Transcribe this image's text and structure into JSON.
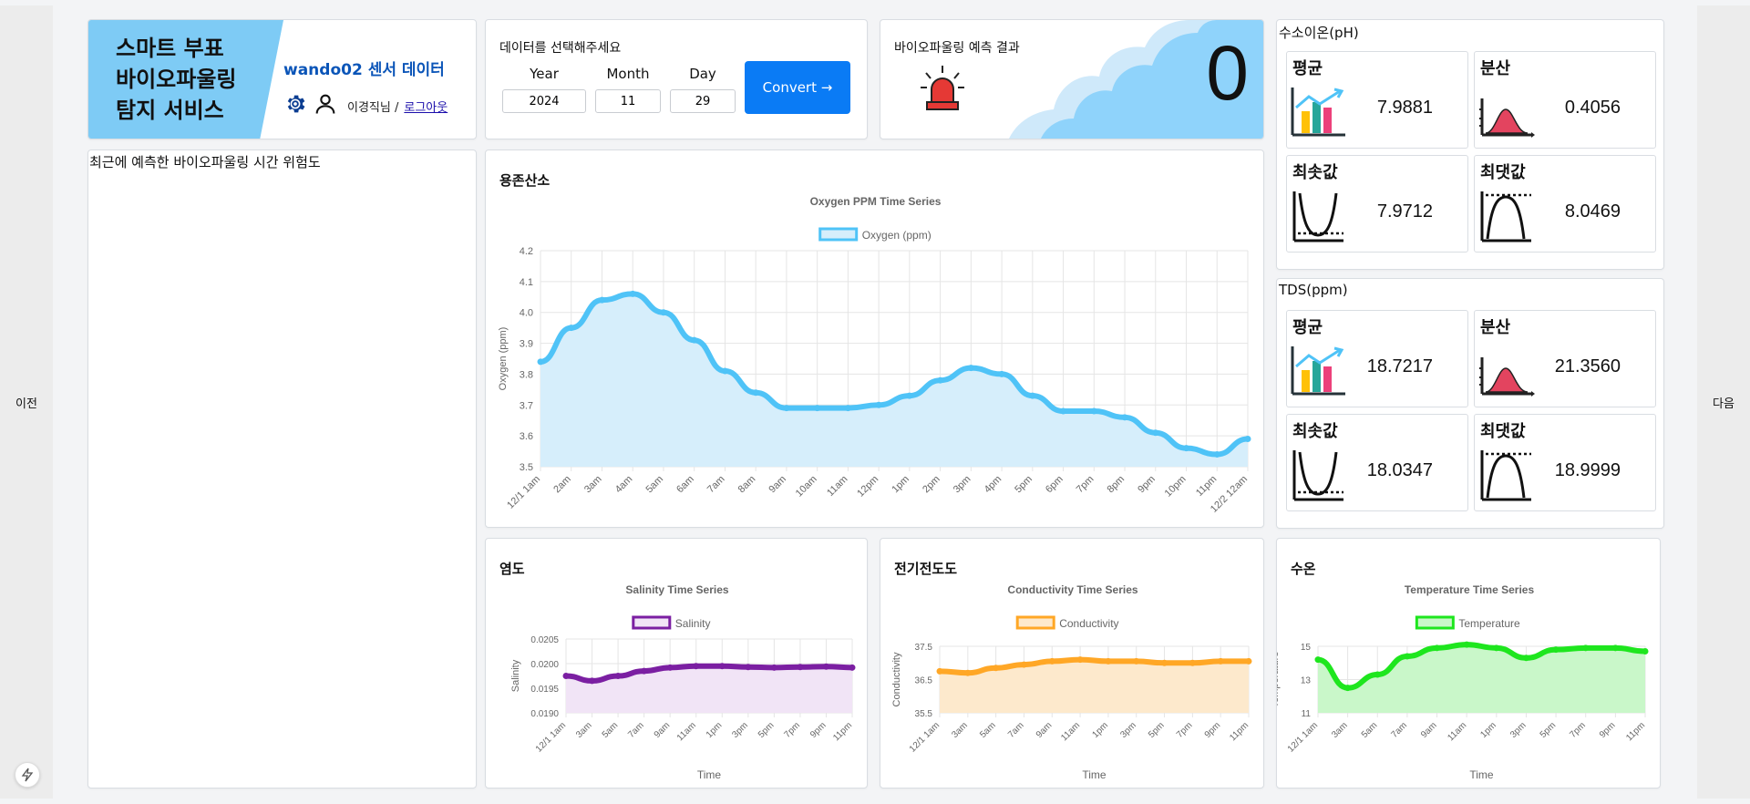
{
  "nav": {
    "prev": "이전",
    "next": "다음"
  },
  "brand": {
    "title_lines": [
      "스마트 부표",
      "바이오파울링",
      "탐지 서비스"
    ],
    "subtitle": "wando02 센서 데이터",
    "user_text": "이경직님 / ",
    "logout": "로그아웃"
  },
  "date_selector": {
    "label": "데이터를 선택해주세요",
    "year_label": "Year",
    "month_label": "Month",
    "day_label": "Day",
    "year": "2024",
    "month": "11",
    "day": "29",
    "convert_label": "Convert →"
  },
  "prediction": {
    "label": "바이오파울링 예측 결과",
    "result": "0"
  },
  "recent": {
    "label": "최근에 예측한 바이오파울링 시간 위험도"
  },
  "colors": {
    "oxygen": "#4fc3f7",
    "oxygen_fill": "#d6eefb",
    "salinity": "#7b1fa2",
    "salinity_fill": "#f1e4f6",
    "conductivity": "#ffa726",
    "conductivity_fill": "#fde9cc",
    "temperature": "#1ee61e",
    "temperature_fill": "#c9f7c9",
    "button": "#0a7bf5",
    "brand_blue": "#7ecbf5"
  },
  "chart_data": [
    {
      "id": "oxygen",
      "panel_label": "용존산소",
      "type": "line",
      "title": "Oxygen PPM Time Series",
      "legend": "Oxygen (ppm)",
      "xlabel": "",
      "ylabel": "Oxygen (ppm)",
      "ylim": [
        3.5,
        4.2
      ],
      "yticks": [
        3.5,
        3.6,
        3.7,
        3.8,
        3.9,
        4.0,
        4.1,
        4.2
      ],
      "categories": [
        "12/1 1am",
        "2am",
        "3am",
        "4am",
        "5am",
        "6am",
        "7am",
        "8am",
        "9am",
        "10am",
        "11am",
        "12pm",
        "1pm",
        "2pm",
        "3pm",
        "4pm",
        "5pm",
        "6pm",
        "7pm",
        "8pm",
        "9pm",
        "10pm",
        "11pm",
        "12/2 12am"
      ],
      "values": [
        3.84,
        3.95,
        4.04,
        4.06,
        4.0,
        3.91,
        3.81,
        3.74,
        3.69,
        3.69,
        3.69,
        3.7,
        3.73,
        3.78,
        3.82,
        3.8,
        3.73,
        3.68,
        3.68,
        3.66,
        3.61,
        3.56,
        3.54,
        3.59
      ],
      "grid": true,
      "legend_position": "top"
    },
    {
      "id": "salinity",
      "panel_label": "염도",
      "type": "line",
      "title": "Salinity Time Series",
      "legend": "Salinity",
      "xlabel": "Time",
      "ylabel": "Salinity",
      "ylim": [
        0.019,
        0.0205
      ],
      "yticks": [
        0.019,
        0.0195,
        0.02,
        0.0205
      ],
      "categories": [
        "12/1 1am",
        "3am",
        "5am",
        "7am",
        "9am",
        "11am",
        "1pm",
        "3pm",
        "5pm",
        "7pm",
        "9pm",
        "11pm"
      ],
      "values": [
        0.01975,
        0.01965,
        0.01975,
        0.01985,
        0.01992,
        0.01995,
        0.01995,
        0.01993,
        0.01992,
        0.01993,
        0.01994,
        0.01992
      ],
      "grid": true,
      "legend_position": "top"
    },
    {
      "id": "conductivity",
      "panel_label": "전기전도도",
      "type": "line",
      "title": "Conductivity Time Series",
      "legend": "Conductivity",
      "xlabel": "Time",
      "ylabel": "Conductivity",
      "ylim": [
        35.5,
        37.5
      ],
      "yticks": [
        35.5,
        36.5,
        37.5
      ],
      "categories": [
        "12/1 1am",
        "3am",
        "5am",
        "7am",
        "9am",
        "11am",
        "1pm",
        "3pm",
        "5pm",
        "7pm",
        "9pm",
        "11pm"
      ],
      "values": [
        36.75,
        36.7,
        36.85,
        36.95,
        37.05,
        37.1,
        37.05,
        37.05,
        37.0,
        37.0,
        37.05,
        37.05
      ],
      "grid": true,
      "legend_position": "top"
    },
    {
      "id": "temperature",
      "panel_label": "수온",
      "type": "line",
      "title": "Temperature Time Series",
      "legend": "Temperature",
      "xlabel": "Time",
      "ylabel": "Temperature",
      "ylim": [
        11,
        15
      ],
      "yticks": [
        11,
        13,
        15
      ],
      "categories": [
        "12/1 1am",
        "3am",
        "5am",
        "7am",
        "9am",
        "11am",
        "1pm",
        "3pm",
        "5pm",
        "7pm",
        "9pm",
        "11pm"
      ],
      "values": [
        14.2,
        12.5,
        13.3,
        14.4,
        14.9,
        15.1,
        14.9,
        14.3,
        14.8,
        14.9,
        14.9,
        14.7
      ],
      "grid": true,
      "legend_position": "top"
    }
  ],
  "stats": [
    {
      "title": "수소이온(pH)",
      "items": [
        {
          "label": "평균",
          "value": "7.9881",
          "icon": "bar-chart-icon"
        },
        {
          "label": "분산",
          "value": "0.4056",
          "icon": "bell-curve-icon"
        },
        {
          "label": "최솟값",
          "value": "7.9712",
          "icon": "min-curve-icon"
        },
        {
          "label": "최댓값",
          "value": "8.0469",
          "icon": "max-curve-icon"
        }
      ]
    },
    {
      "title": "TDS(ppm)",
      "items": [
        {
          "label": "평균",
          "value": "18.7217",
          "icon": "bar-chart-icon"
        },
        {
          "label": "분산",
          "value": "21.3560",
          "icon": "bell-curve-icon"
        },
        {
          "label": "최솟값",
          "value": "18.0347",
          "icon": "min-curve-icon"
        },
        {
          "label": "최댓값",
          "value": "18.9999",
          "icon": "max-curve-icon"
        }
      ]
    }
  ]
}
